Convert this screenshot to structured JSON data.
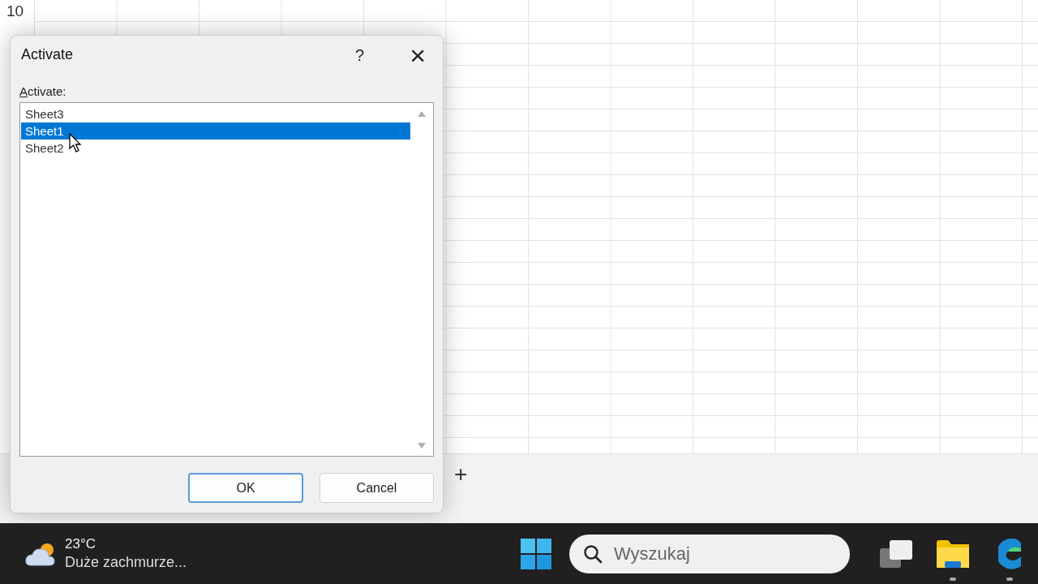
{
  "sheet": {
    "row_numbers": [
      "10"
    ],
    "add_sheet": "+"
  },
  "dialog": {
    "title": "Activate",
    "help": "?",
    "close": "×",
    "list_label": "Activate:",
    "items": [
      {
        "label": "Sheet3",
        "selected": false
      },
      {
        "label": "Sheet1",
        "selected": true
      },
      {
        "label": "Sheet2",
        "selected": false
      }
    ],
    "buttons": [
      {
        "label": "OK",
        "kind": "default"
      },
      {
        "label": "Cancel",
        "kind": "normal"
      }
    ]
  },
  "taskbar": {
    "temperature": "23°C",
    "weather": "Duże zachmurze...",
    "search": {
      "placeholder": "Wyszukaj"
    },
    "apps": [
      {
        "kind": "taskview",
        "running": false
      },
      {
        "kind": "folder",
        "running": true
      },
      {
        "kind": "browser",
        "running": true
      }
    ]
  }
}
